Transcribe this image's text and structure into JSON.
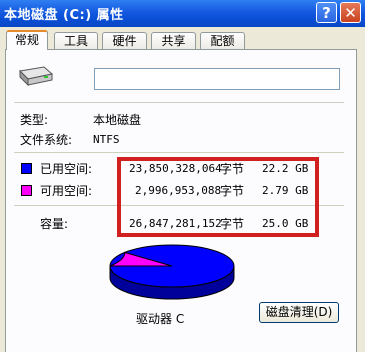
{
  "window": {
    "title": "本地磁盘 (C:) 属性",
    "help_label": "?",
    "close_label": "✕"
  },
  "tabs": [
    {
      "label": "常规",
      "active": true
    },
    {
      "label": "工具"
    },
    {
      "label": "硬件"
    },
    {
      "label": "共享"
    },
    {
      "label": "配额"
    }
  ],
  "general": {
    "volume_name": "",
    "type_label": "类型:",
    "type_value": "本地磁盘",
    "fs_label": "文件系统:",
    "fs_value": "NTFS",
    "used": {
      "label": "已用空间:",
      "bytes": "23,850,328,064",
      "unit": "字节",
      "size": "22.2 GB",
      "color": "#0000ff"
    },
    "free": {
      "label": "可用空间:",
      "bytes": "2,996,953,088",
      "unit": "字节",
      "size": "2.79 GB",
      "color": "#ff00ff"
    },
    "capacity": {
      "label": "容量:",
      "bytes": "26,847,281,152",
      "unit": "字节",
      "size": "25.0 GB"
    },
    "used_fraction": 0.888,
    "drive_label": "驱动器 C",
    "cleanup_label": "磁盘清理(D)"
  },
  "icons": {
    "drive": "hard-drive-icon"
  }
}
